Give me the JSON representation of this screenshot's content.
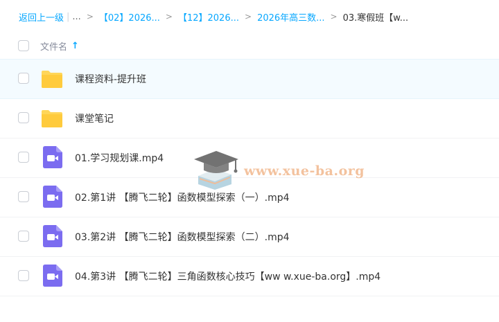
{
  "breadcrumb": {
    "back_label": "返回上一级",
    "ellipsis": "...",
    "items": [
      "【02】2026...",
      "【12】2026...",
      "2026年高三数..."
    ],
    "current": "03.寒假班【w..."
  },
  "header": {
    "column_label": "文件名",
    "sort_direction": "ascending"
  },
  "files": [
    {
      "name": "课程资料-提升班",
      "type": "folder",
      "selected": true
    },
    {
      "name": "课堂笔记",
      "type": "folder",
      "selected": false
    },
    {
      "name": "01.学习规划课.mp4",
      "type": "video",
      "selected": false
    },
    {
      "name": "02.第1讲 【腾飞二轮】函数模型探索（一）.mp4",
      "type": "video",
      "selected": false
    },
    {
      "name": "03.第2讲 【腾飞二轮】函数模型探索（二）.mp4",
      "type": "video",
      "selected": false
    },
    {
      "name": "04.第3讲 【腾飞二轮】三角函数核心技巧【ww w.xue-ba.org】.mp4",
      "type": "video",
      "selected": false
    }
  ],
  "watermark": {
    "text": "www.xue-ba.org"
  },
  "colors": {
    "accent": "#06a7ff",
    "folder": "#ffd659",
    "video_icon": "#7b6cf0",
    "selected_row": "#f4fbff"
  }
}
